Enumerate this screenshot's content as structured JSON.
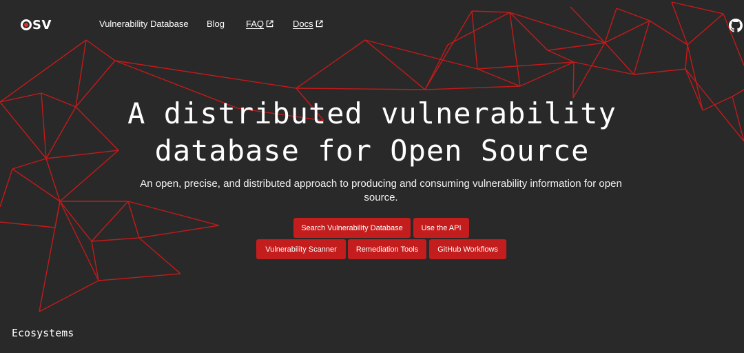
{
  "brand": {
    "logo_text": "SV",
    "accent_color": "#c41d1d"
  },
  "nav": {
    "links": [
      {
        "label": "Vulnerability Database",
        "external": false
      },
      {
        "label": "Blog",
        "external": false
      },
      {
        "label": "FAQ",
        "external": true,
        "icon": "external-link-icon"
      },
      {
        "label": "Docs",
        "external": true,
        "icon": "external-link-icon"
      }
    ],
    "github_icon": "github-icon"
  },
  "hero": {
    "title_line1": "A distributed vulnerability",
    "title_line2": "database for Open Source",
    "subtitle": "An open, precise, and distributed approach to producing and consuming vulnerability information for open source.",
    "buttons_row1": [
      "Search Vulnerability Database",
      "Use the API"
    ],
    "buttons_row2": [
      "Vulnerability Scanner",
      "Remediation Tools",
      "GitHub Workflows"
    ]
  },
  "sections": {
    "ecosystems_heading": "Ecosystems"
  }
}
